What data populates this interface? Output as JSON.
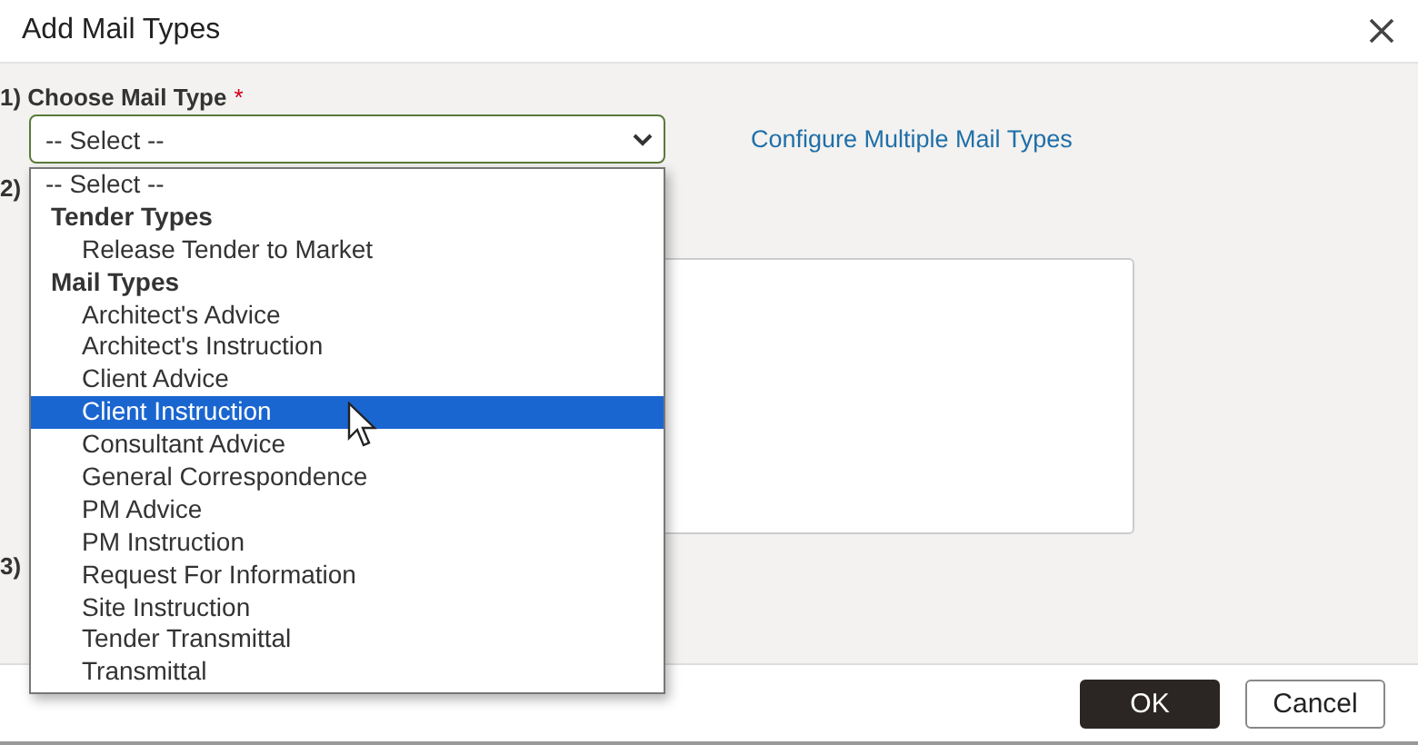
{
  "dialog": {
    "title": "Add Mail Types"
  },
  "step_1": {
    "label": "1) Choose Mail Type",
    "required_mark": "*",
    "select": {
      "value": "-- Select --",
      "open": true
    },
    "link": "Configure Multiple Mail Types"
  },
  "step_2": {
    "label": "2)"
  },
  "step_3": {
    "label": "3)"
  },
  "dropdown": [
    {
      "kind": "option",
      "label": "-- Select --",
      "selected": false
    },
    {
      "kind": "group",
      "label": "Tender Types",
      "children": [
        {
          "kind": "option",
          "label": "Release Tender to Market",
          "selected": false
        }
      ]
    },
    {
      "kind": "group",
      "label": "Mail Types",
      "children": [
        {
          "kind": "option",
          "label": "Architect's Advice",
          "selected": false
        },
        {
          "kind": "option",
          "label": "Architect's Instruction",
          "selected": false
        },
        {
          "kind": "option",
          "label": "Client Advice",
          "selected": false
        },
        {
          "kind": "option",
          "label": "Client Instruction",
          "selected": true
        },
        {
          "kind": "option",
          "label": "Consultant Advice",
          "selected": false
        },
        {
          "kind": "option",
          "label": "General Correspondence",
          "selected": false
        },
        {
          "kind": "option",
          "label": "PM Advice",
          "selected": false
        },
        {
          "kind": "option",
          "label": "PM Instruction",
          "selected": false
        },
        {
          "kind": "option",
          "label": "Request For Information",
          "selected": false
        },
        {
          "kind": "option",
          "label": "Site Instruction",
          "selected": false
        },
        {
          "kind": "option",
          "label": "Tender Transmittal",
          "selected": false
        },
        {
          "kind": "option",
          "label": "Transmittal",
          "selected": false
        }
      ]
    }
  ],
  "buttons": [
    {
      "label": "OK",
      "kind": "primary"
    },
    {
      "label": "Cancel",
      "kind": "secondary"
    }
  ]
}
